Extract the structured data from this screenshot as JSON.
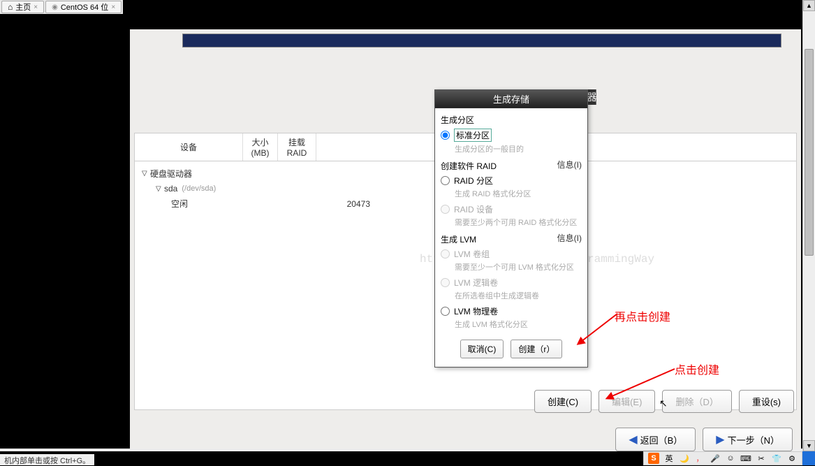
{
  "tabs": {
    "home": "主页",
    "centos": "CentOS 64 位"
  },
  "table": {
    "device": "设备",
    "size": "大小",
    "size_unit": "(MB)",
    "mount": "挂载",
    "raid": "RAID"
  },
  "tree": {
    "hdd": "硬盘驱动器",
    "sda": "sda",
    "sda_path": "(/dev/sda)",
    "free": "空闲",
    "free_size": "20473"
  },
  "modal": {
    "title": "生成存储",
    "overflow_char": "器",
    "sect1": "生成分区",
    "opt1": "标准分区",
    "hint1": "生成分区的一般目的",
    "sect2": "创建软件 RAID",
    "info": "信息(I)",
    "opt2": "RAID 分区",
    "hint2": "生成 RAID 格式化分区",
    "opt3": "RAID 设备",
    "hint3": "需要至少两个可用 RAID 格式化分区",
    "sect3": "生成 LVM",
    "opt4": "LVM 卷组",
    "hint4": "需要至少一个可用 LVM 格式化分区",
    "opt5": "LVM 逻辑卷",
    "hint5": "在所选卷组中生成逻辑卷",
    "opt6": "LVM 物理卷",
    "hint6": "生成 LVM 格式化分区",
    "cancel": "取消(C)",
    "create": "创建（r）"
  },
  "annotations": {
    "a1": "再点击创建",
    "a2": "点击创建"
  },
  "buttons": {
    "create": "创建(C)",
    "edit": "编辑(E)",
    "delete": "删除（D）",
    "reset": "重设(s)",
    "back": "返回（B）",
    "next": "下一步（N）"
  },
  "watermark": "http://blog.csdn.net/ProgrammingWay",
  "status": "机内部单击或按 Ctrl+G。",
  "ime": {
    "lang": "英",
    "moon": "🌙",
    "mic": "🎤",
    "face": "☺",
    "kbd": "⌨",
    "tool": "✂",
    "shirt": "👕",
    "gear": "⚙"
  }
}
